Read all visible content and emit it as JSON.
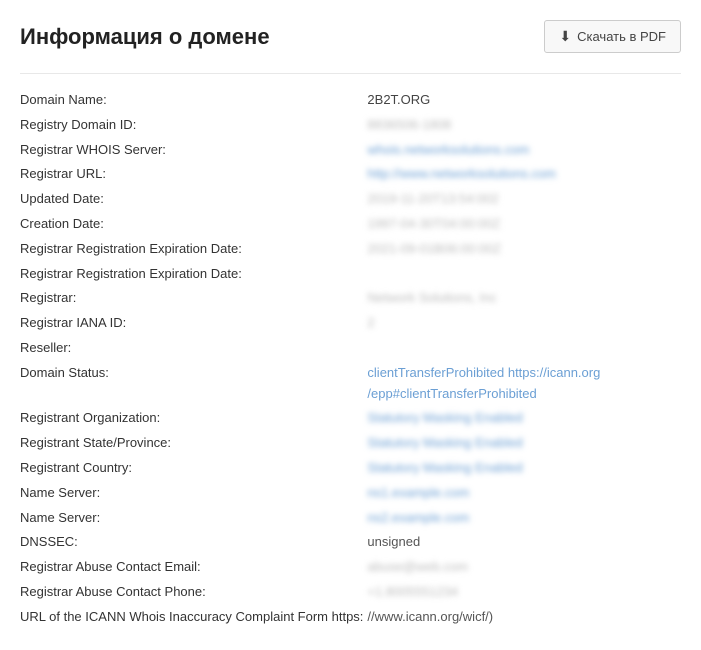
{
  "header": {
    "title": "Информация о домене",
    "pdf_button_label": "Скачать в PDF"
  },
  "whois": {
    "rows": [
      {
        "label": "Domain Name:",
        "value": "2B2T.ORG",
        "type": "plain-bold"
      },
      {
        "label": "Registry Domain ID:",
        "value": "8836506-1808",
        "type": "blurred"
      },
      {
        "label": "Registrar WHOIS Server:",
        "value": "whois.networksolutions.com",
        "type": "link-blurred"
      },
      {
        "label": "Registrar URL:",
        "value": "http://www.networksolutions.com",
        "type": "link-blurred"
      },
      {
        "label": "Updated Date:",
        "value": "2019-11-20T13:54:002",
        "type": "blurred"
      },
      {
        "label": "Creation Date:",
        "value": "1997-04-30T04:00:00Z",
        "type": "blurred"
      },
      {
        "label": "Registrar Registration Expiration Date:",
        "value": "2021-09-01B06:00:00Z",
        "type": "blurred"
      },
      {
        "label": "Registrar Registration Expiration Date:",
        "value": "",
        "type": "empty"
      },
      {
        "label": "Registrar:",
        "value": "Network Solutions, Inc",
        "type": "blurred"
      },
      {
        "label": "Registrar IANA ID:",
        "value": "2",
        "type": "blurred"
      },
      {
        "label": "Reseller:",
        "value": "",
        "type": "empty"
      },
      {
        "label": "Domain Status:",
        "value": "clientTransferProhibited https://icann.org /epp#clientTransferProhibited",
        "type": "link-status"
      },
      {
        "label": "Registrant Organization:",
        "value": "Statutory Masking Enabled",
        "type": "link-blurred"
      },
      {
        "label": "Registrant State/Province:",
        "value": "Statutory Masking Enabled",
        "type": "link-blurred"
      },
      {
        "label": "Registrant Country:",
        "value": "Statutory Masking Enabled",
        "type": "link-blurred"
      },
      {
        "label": "Name Server:",
        "value": "ns1.example.com",
        "type": "link-blurred"
      },
      {
        "label": "Name Server:",
        "value": "ns2.example.com",
        "type": "link-blurred"
      },
      {
        "label": "DNSSEC:",
        "value": "unsigned",
        "type": "plain"
      },
      {
        "label": "Registrar Abuse Contact Email:",
        "value": "abuse@web.com",
        "type": "blurred"
      },
      {
        "label": "Registrar Abuse Contact Phone:",
        "value": "+1.8005551234",
        "type": "blurred"
      },
      {
        "label": "URL of the ICANN Whois Inaccuracy Complaint Form https:",
        "value": "//www.icann.org/wicf/)",
        "type": "plain"
      }
    ]
  }
}
